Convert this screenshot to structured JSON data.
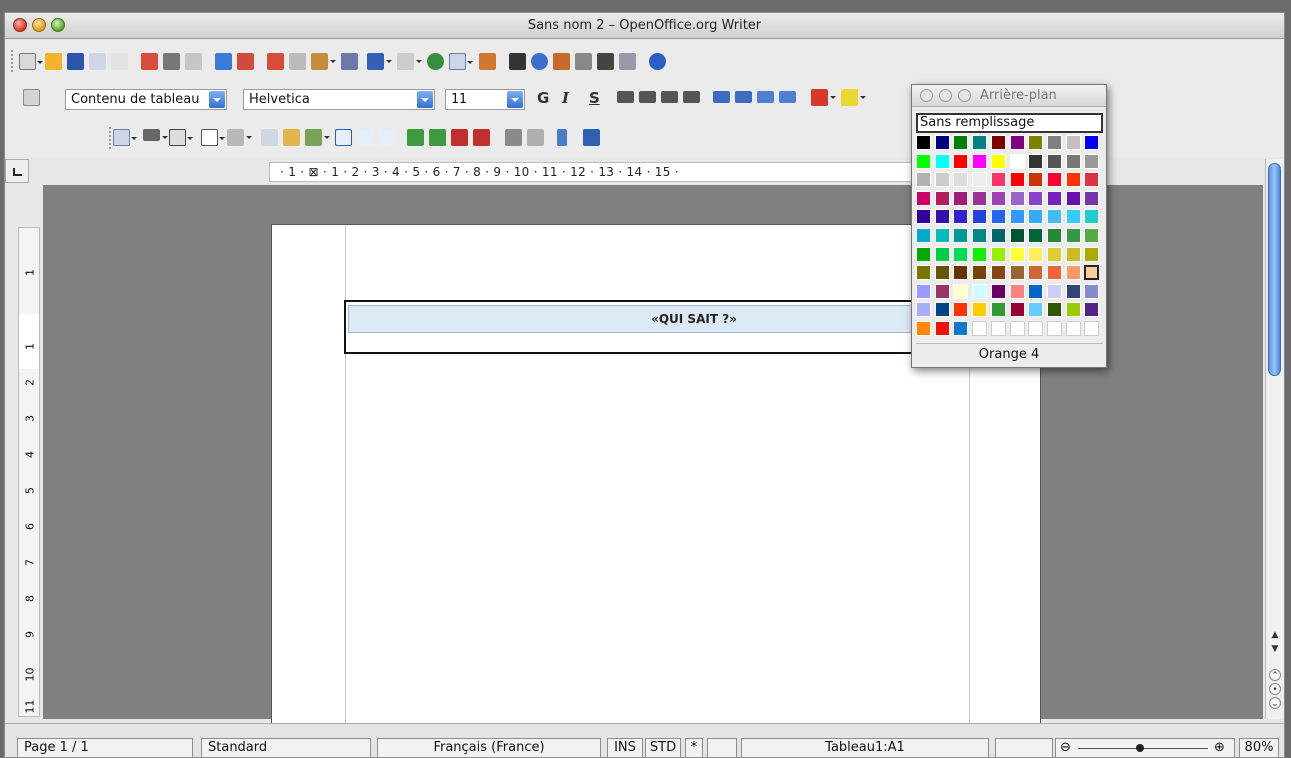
{
  "window": {
    "title": "Sans nom 2 – OpenOffice.org Writer"
  },
  "formatting": {
    "paragraph_style": "Contenu de tableau",
    "font_name": "Helvetica",
    "font_size": "11",
    "bold_label": "G",
    "italic_label": "I",
    "underline_label": "S"
  },
  "ruler": {
    "horizontal": "· 1 · ⊠ · 1 · 2 · 3 · 4 · 5 · 6 · 7 · 8 · 9 · 10 · 11 · 12 · 13 · 14 · 15 ·",
    "vertical_numbers": [
      "1",
      "1",
      "2",
      "3",
      "4",
      "5",
      "6",
      "7",
      "8",
      "9",
      "10",
      "11"
    ]
  },
  "document": {
    "cell_text": "«QUI SAIT ?»"
  },
  "background_popup": {
    "title": "Arrière-plan",
    "no_fill_label": "Sans remplissage",
    "selected_color_name": "Orange 4",
    "colors": [
      [
        "#000000",
        "#000080",
        "#008000",
        "#008080",
        "#800000",
        "#800080",
        "#808000",
        "#808080",
        "#c0c0c0",
        "#0000ff"
      ],
      [
        "#00ff00",
        "#00ffff",
        "#ff0000",
        "#ff00ff",
        "#ffff00",
        "#ffffff",
        "#333333",
        "#555555",
        "#777777",
        "#999999"
      ],
      [
        "#b2b2b2",
        "#cccccc",
        "#dddddd",
        "#eeeeee",
        "#ff3366",
        "#ff0000",
        "#cc3300",
        "#ff0033",
        "#ff3300",
        "#dd3344"
      ],
      [
        "#cc0066",
        "#b31e5a",
        "#a01e78",
        "#993399",
        "#a040b0",
        "#9966cc",
        "#8844cc",
        "#7722bb",
        "#6611aa",
        "#7733aa"
      ],
      [
        "#330099",
        "#3311aa",
        "#3322cc",
        "#2244dd",
        "#2266ee",
        "#3399ff",
        "#33aaff",
        "#44bbff",
        "#33ccff",
        "#22cccc"
      ],
      [
        "#00aacc",
        "#00bbbb",
        "#009999",
        "#008888",
        "#006666",
        "#005533",
        "#006633",
        "#228833",
        "#339944",
        "#55aa44"
      ],
      [
        "#00aa00",
        "#00cc44",
        "#00dd55",
        "#11ee00",
        "#99ee00",
        "#ffff33",
        "#ffee55",
        "#ddcc33",
        "#ccbb22",
        "#aaaa00"
      ],
      [
        "#777700",
        "#665500",
        "#663300",
        "#774400",
        "#884411",
        "#996633",
        "#cc6633",
        "#ee6633",
        "#ff9966",
        "#ffcc99"
      ],
      [
        "#9999ff",
        "#993366",
        "#ffffcc",
        "#ccffff",
        "#660066",
        "#ff8080",
        "#0066cc",
        "#ccccff",
        "#334477",
        "#8888cc"
      ],
      [
        "#aaaaff",
        "#004488",
        "#ff3300",
        "#ffcc00",
        "#339933",
        "#990033",
        "#66ccff",
        "#335500",
        "#99cc00",
        "#552288"
      ],
      [
        "#ff8800",
        "#ee1100",
        "#1177cc",
        "#ffffff",
        "#ffffff",
        "#ffffff",
        "#ffffff",
        "#ffffff",
        "#ffffff",
        "#ffffff"
      ]
    ]
  },
  "statusbar": {
    "page": "Page 1 / 1",
    "style": "Standard",
    "language": "Français (France)",
    "ins": "INS",
    "std": "STD",
    "modified": "*",
    "table_cell": "Tableau1:A1",
    "zoom": "80%"
  }
}
